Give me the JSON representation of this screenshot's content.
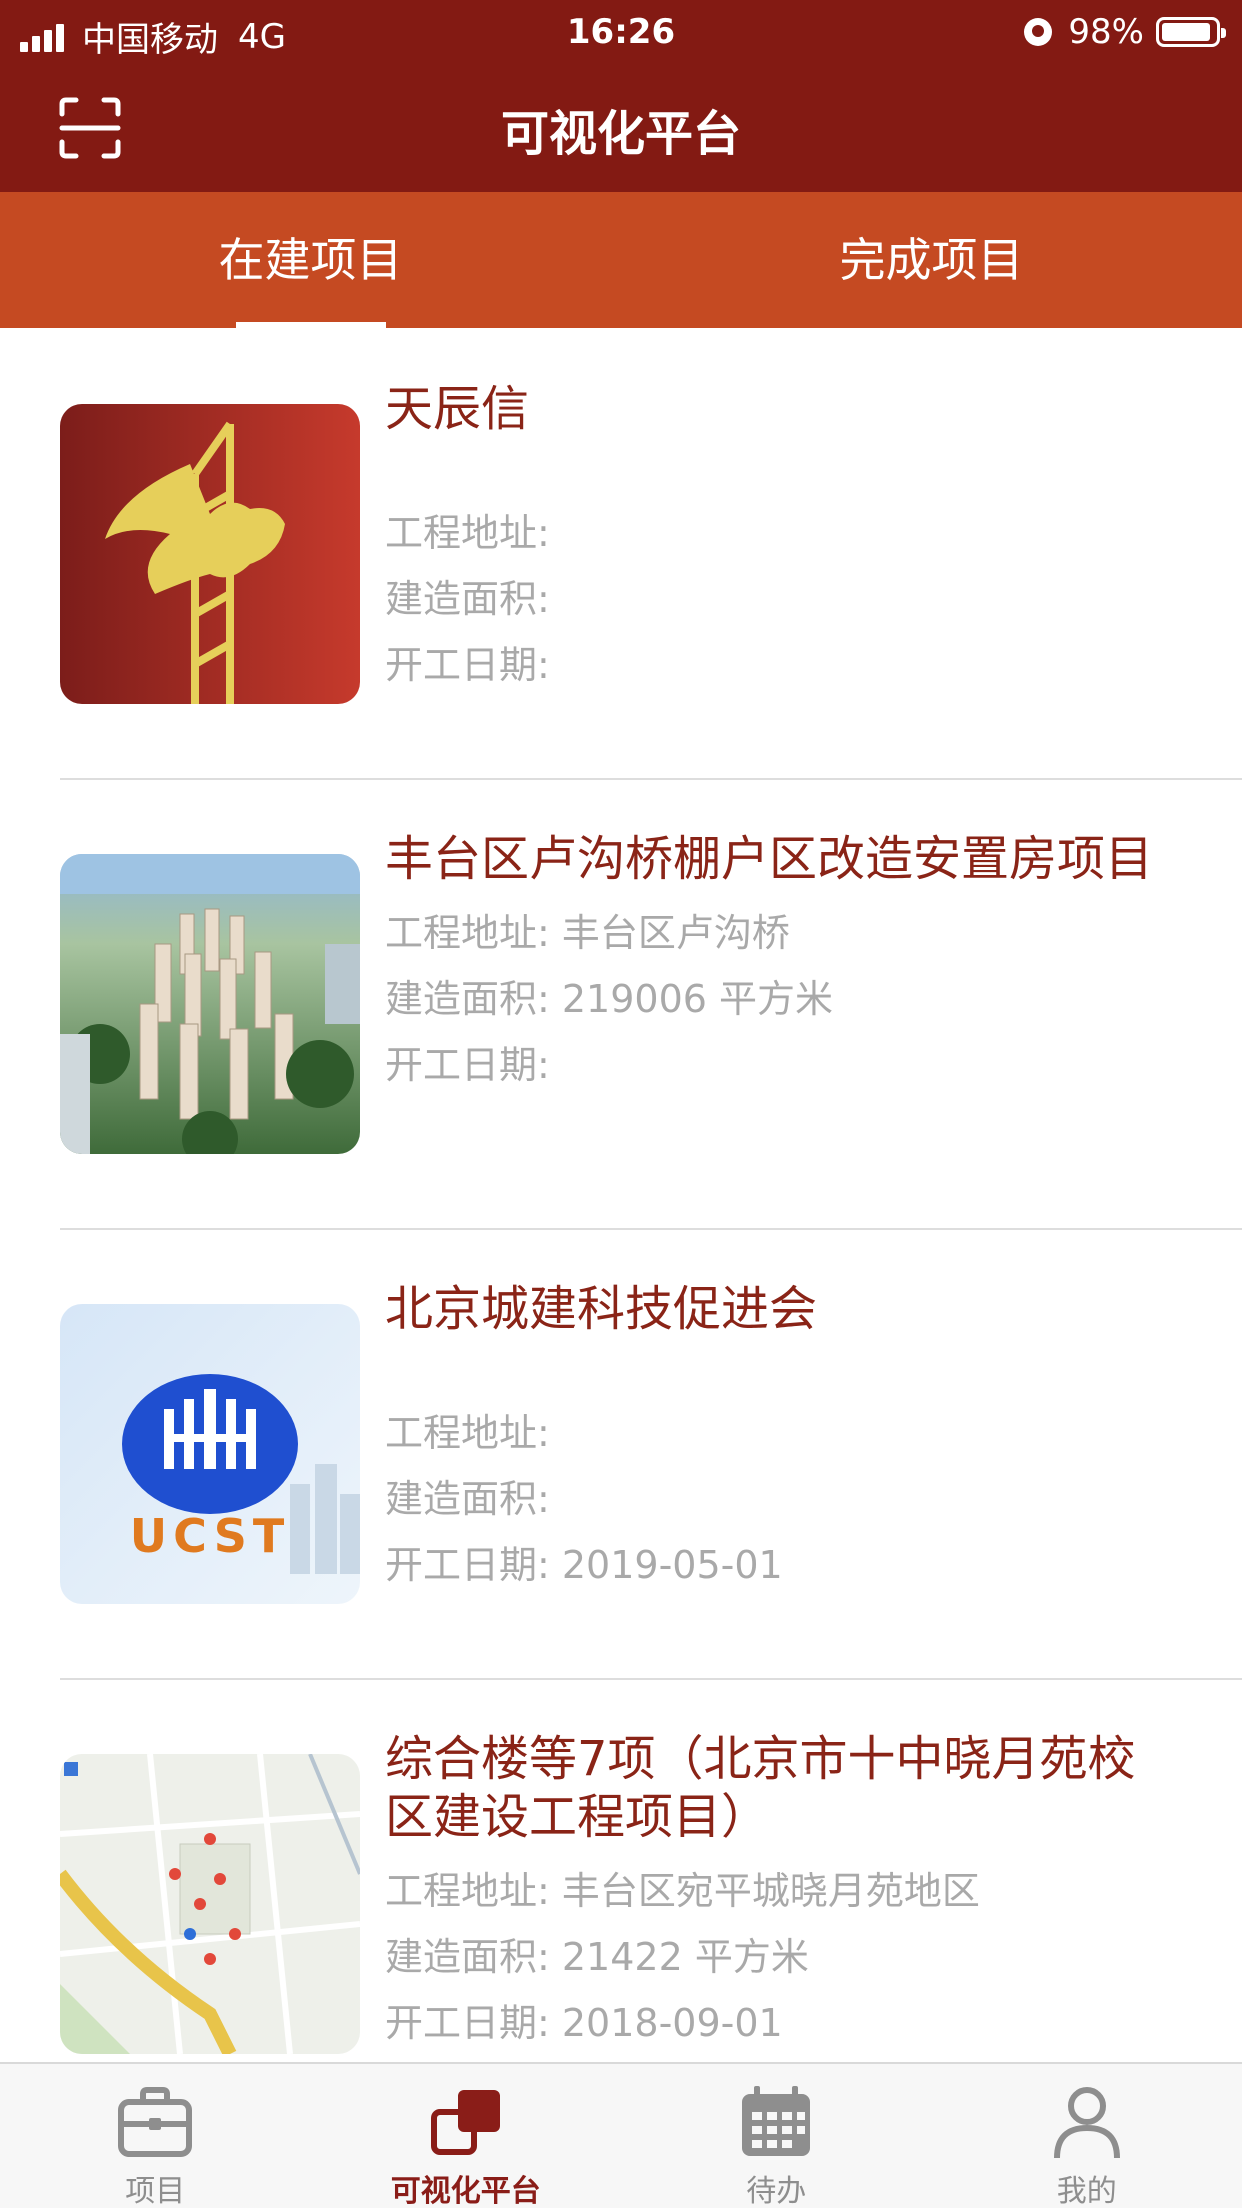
{
  "status_bar": {
    "carrier": "中国移动",
    "network": "4G",
    "time": "16:26",
    "battery": "98%"
  },
  "header": {
    "title": "可视化平台",
    "scan_icon": "scan-icon"
  },
  "tabs": [
    {
      "label": "在建项目",
      "active": true
    },
    {
      "label": "完成项目",
      "active": false
    }
  ],
  "projects": [
    {
      "title": "天辰信",
      "address": "工程地址:",
      "area": "建造面积:",
      "start_date": "开工日期:",
      "thumb": "tower-crane-logo"
    },
    {
      "title": "丰台区卢沟桥棚户区改造安置房项目",
      "address": "工程地址: 丰台区卢沟桥",
      "area": "建造面积: 219006 平方米",
      "start_date": "开工日期:",
      "thumb": "residential-aerial-photo"
    },
    {
      "title": "北京城建科技促进会",
      "address": "工程地址:",
      "area": "建造面积:",
      "start_date": "开工日期: 2019-05-01",
      "thumb": "ucst-logo",
      "thumb_text": "UCST"
    },
    {
      "title": "综合楼等7项（北京市十中晓月苑校区建设工程项目）",
      "address": "工程地址: 丰台区宛平城晓月苑地区",
      "area": "建造面积: 21422 平方米",
      "start_date": "开工日期: 2018-09-01",
      "thumb": "site-map"
    }
  ],
  "tabbar": [
    {
      "label": "项目",
      "icon": "briefcase-icon",
      "active": false
    },
    {
      "label": "可视化平台",
      "icon": "visualization-icon",
      "active": true
    },
    {
      "label": "待办",
      "icon": "calendar-icon",
      "active": false
    },
    {
      "label": "我的",
      "icon": "person-icon",
      "active": false
    }
  ],
  "colors": {
    "header_bg": "#831a13",
    "tab_bg": "#c54a22",
    "title_text": "#8a2417",
    "meta_text": "#a9a9a9"
  }
}
